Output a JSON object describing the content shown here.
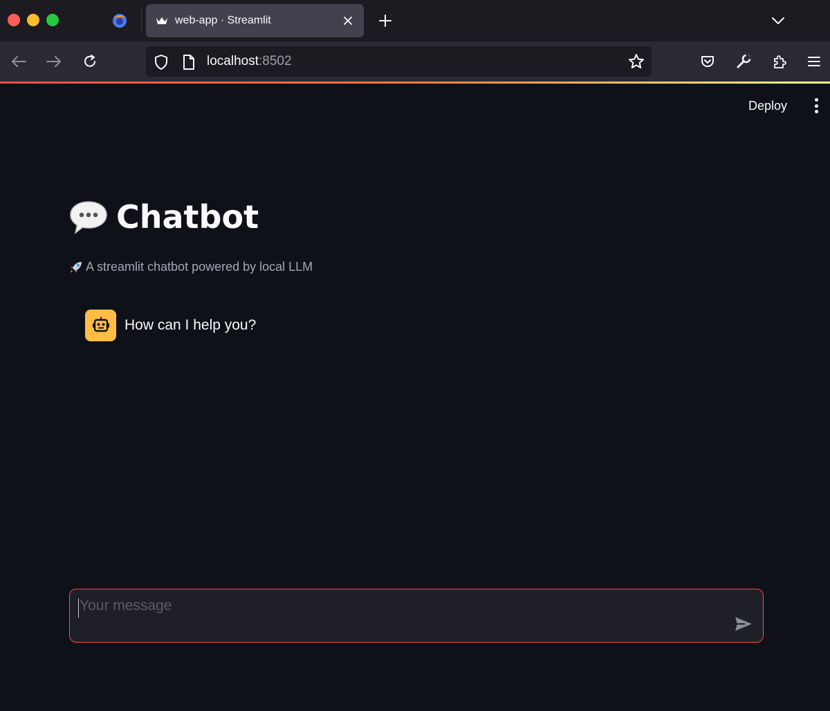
{
  "browser": {
    "tab_title": "web-app · Streamlit",
    "url_host": "localhost",
    "url_port": ":8502"
  },
  "header": {
    "deploy_label": "Deploy"
  },
  "main": {
    "title": "Chatbot",
    "subtitle": "A streamlit chatbot powered by local LLM",
    "messages": [
      {
        "role": "assistant",
        "text": "How can I help you?"
      }
    ]
  },
  "chat_input": {
    "placeholder": "Your message",
    "value": ""
  },
  "colors": {
    "background": "#0e1117",
    "accent": "#ff4b4b",
    "avatar": "#ffbd45"
  },
  "icons": {
    "title_icon": "speech-balloon-icon",
    "subtitle_icon": "rocket-icon",
    "avatar_icon": "robot-icon"
  }
}
